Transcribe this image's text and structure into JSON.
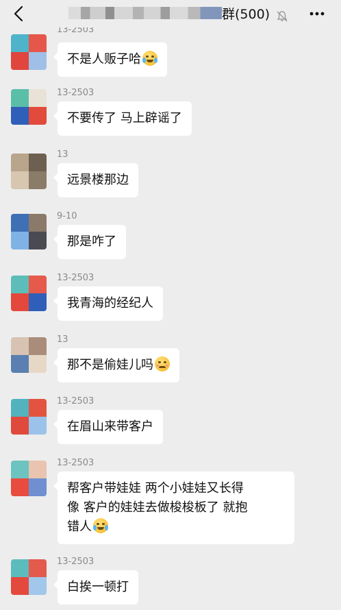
{
  "header": {
    "title_visible": "群(500)",
    "back_icon": "chevron-left-icon",
    "mute_icon": "bell-muted-icon",
    "more_icon": "more-dots-icon"
  },
  "messages": [
    {
      "name": "13-2503",
      "text": "不是人贩子哈",
      "emoji": "laugh-cry"
    },
    {
      "name": "13-2503",
      "text": "不要传了 马上辟谣了"
    },
    {
      "name": "13",
      "text": "远景楼那边"
    },
    {
      "name": "9-10",
      "text": "那是咋了"
    },
    {
      "name": "13-2503",
      "text": "我青海的经纪人"
    },
    {
      "name": "13",
      "text": "那不是偷娃儿吗",
      "emoji": "awkward"
    },
    {
      "name": "13-2503",
      "text": "在眉山来带客户"
    },
    {
      "name": "13-2503",
      "lines": [
        "帮客户带娃娃  两个小娃娃又长得",
        "像  客户的娃娃去做梭梭板了 就抱",
        "错人"
      ],
      "emoji": "laugh-cry"
    },
    {
      "name": "13-2503",
      "text": "白挨一顿打"
    }
  ],
  "colors": {
    "background": "#ededed",
    "bubble": "#ffffff",
    "name_text": "#8a8a8a"
  }
}
